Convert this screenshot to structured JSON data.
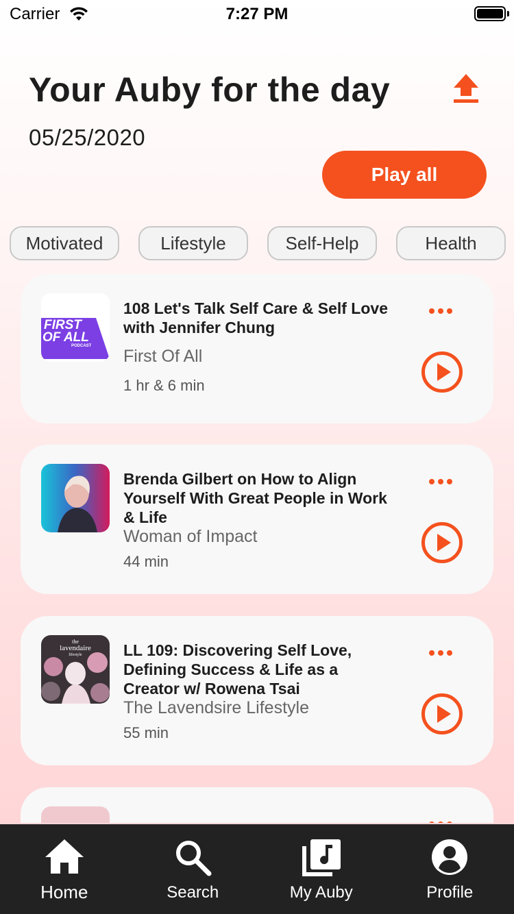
{
  "status_bar": {
    "carrier": "Carrier",
    "time": "7:27 PM"
  },
  "header": {
    "title": "Your Auby for the day",
    "date": "05/25/2020",
    "play_all_label": "Play all"
  },
  "categories": [
    "Motivated",
    "Lifestyle",
    "Self-Help",
    "Health"
  ],
  "episodes": [
    {
      "title": "108 Let's Talk Self Care & Self Love with Jennifer Chung",
      "podcast": "First Of All",
      "duration": "1 hr & 6 min",
      "art_text_1": "FIRST",
      "art_text_2": "OF ALL",
      "art_text_3": "PODCAST"
    },
    {
      "title": "Brenda Gilbert on How to Align Yourself With Great People in Work & Life",
      "podcast": "Woman of Impact",
      "duration": "44 min"
    },
    {
      "title": "LL 109: Discovering Self Love, Defining Success & Life as a Creator w/ Rowena Tsai",
      "podcast": "The Lavendsire Lifestyle",
      "duration": "55 min",
      "art_text_1": "the",
      "art_text_2": "lavendaire",
      "art_text_3": "lifestyle"
    },
    {
      "title": "",
      "podcast": "",
      "duration": ""
    }
  ],
  "tabs": [
    {
      "label": "Home",
      "icon": "home-icon"
    },
    {
      "label": "Search",
      "icon": "search-icon"
    },
    {
      "label": "My Auby",
      "icon": "library-music-icon"
    },
    {
      "label": "Profile",
      "icon": "profile-icon"
    }
  ],
  "colors": {
    "accent": "#f4511e",
    "tab_bar": "#222222",
    "card": "#f8f8f8"
  }
}
